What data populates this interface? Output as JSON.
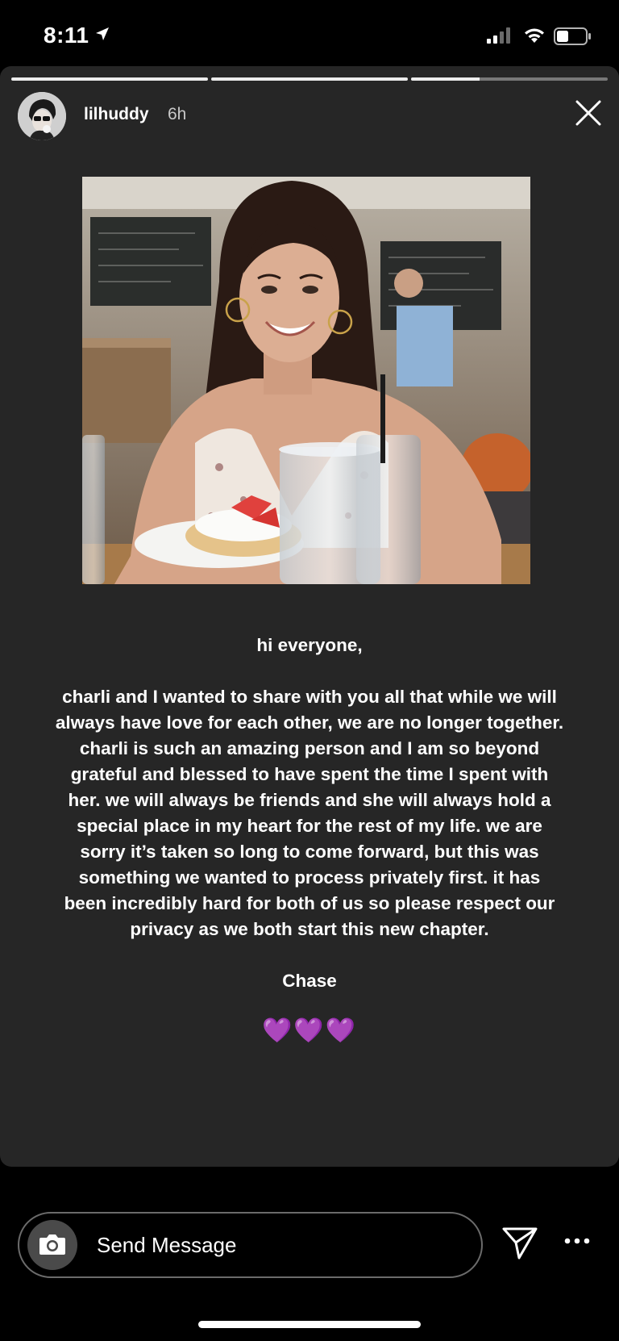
{
  "status_bar": {
    "time": "8:11",
    "icons": [
      "location-arrow-icon",
      "cellular-signal-icon",
      "wifi-icon",
      "battery-icon"
    ]
  },
  "story": {
    "progress_segments": [
      1.0,
      1.0,
      0.35
    ],
    "username": "lilhuddy",
    "time_ago": "6h",
    "close_icon": "close-icon",
    "caption": {
      "greeting": "hi everyone,",
      "lines": [
        "charli and I wanted to share with you all that while we will",
        "always have love for each other, we are no longer together.",
        "charli is such an amazing person and I am so beyond",
        "grateful and blessed to have spent the time I spent with",
        "her. we will always be friends and she will always hold a",
        "special place in my heart for the rest of my life. we are",
        "sorry it’s taken so long to come forward, but this was",
        "something we wanted to process privately first. it has",
        "been incredibly hard for both of us so please respect our",
        "privacy as we both start this new chapter."
      ],
      "signoff": "Chase",
      "hearts": "💜💜💜"
    }
  },
  "reply_bar": {
    "placeholder": "Send Message",
    "camera_icon": "camera-icon",
    "share_icon": "paper-plane-icon",
    "more_icon": "more-dots-icon"
  },
  "colors": {
    "story_background": "#262626",
    "page_background": "#000000",
    "heart": "#9b4be6"
  }
}
